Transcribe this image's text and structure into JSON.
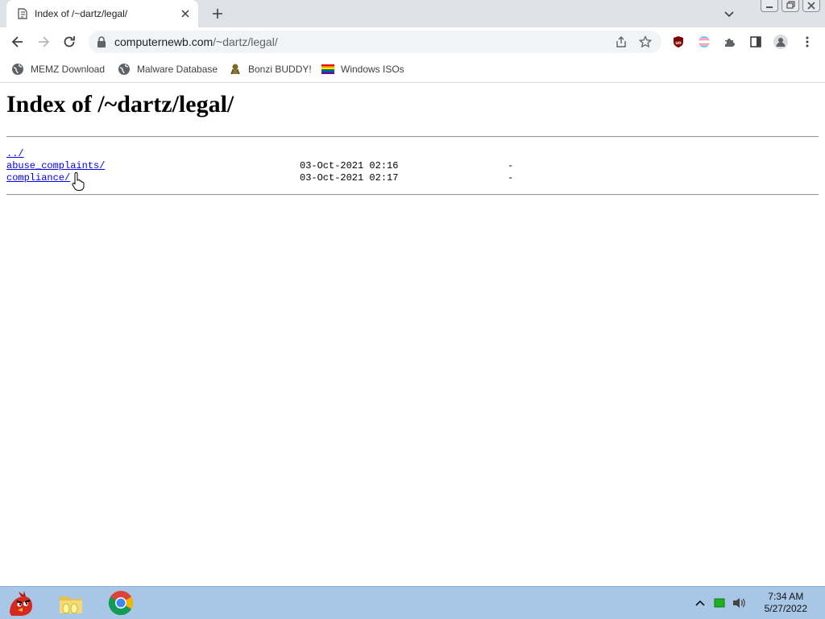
{
  "tab": {
    "title": "Index of /~dartz/legal/"
  },
  "address": {
    "host": "computernewb.com",
    "path": "/~dartz/legal/"
  },
  "bookmarks": [
    {
      "label": "MEMZ Download",
      "icon": "globe-icon"
    },
    {
      "label": "Malware Database",
      "icon": "globe-icon"
    },
    {
      "label": "Bonzi BUDDY!",
      "icon": "bonzi-icon"
    },
    {
      "label": "Windows ISOs",
      "icon": "rainbow-flag-icon"
    }
  ],
  "page": {
    "heading": "Index of /~dartz/legal/",
    "entries": [
      {
        "name": "../",
        "date": "",
        "size": ""
      },
      {
        "name": "abuse_complaints/",
        "date": "03-Oct-2021 02:16",
        "size": "-"
      },
      {
        "name": "compliance/",
        "date": "03-Oct-2021 02:17",
        "size": "-"
      }
    ]
  },
  "taskbar": {
    "apps": [
      "angry-bird-icon",
      "folder-icon",
      "chrome-icon"
    ],
    "time": "7:34 AM",
    "date": "5/27/2022"
  },
  "colors": {
    "link": "#0000ee",
    "taskbar": "#a8c6e6",
    "tabstrip": "#dee1e6"
  }
}
